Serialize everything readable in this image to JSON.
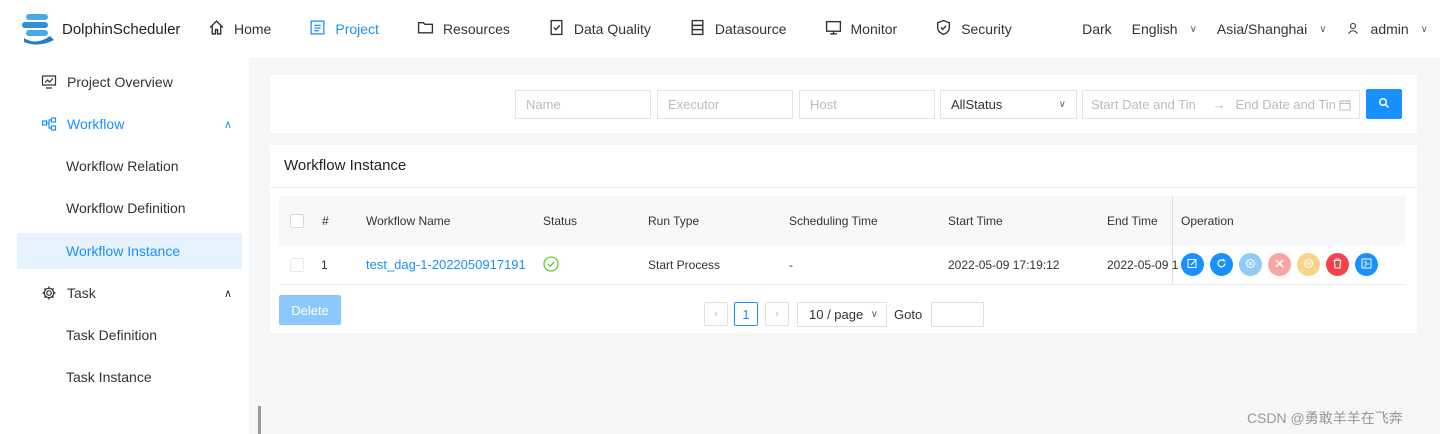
{
  "app": {
    "name": "DolphinScheduler"
  },
  "nav": [
    {
      "label": "Home",
      "icon": "home-icon",
      "active": false
    },
    {
      "label": "Project",
      "icon": "project-icon",
      "active": true
    },
    {
      "label": "Resources",
      "icon": "folder-icon",
      "active": false
    },
    {
      "label": "Data Quality",
      "icon": "data-quality-icon",
      "active": false
    },
    {
      "label": "Datasource",
      "icon": "datasource-icon",
      "active": false
    },
    {
      "label": "Monitor",
      "icon": "monitor-icon",
      "active": false
    },
    {
      "label": "Security",
      "icon": "shield-icon",
      "active": false
    }
  ],
  "header_right": {
    "theme": "Dark",
    "language": "English",
    "timezone": "Asia/Shanghai",
    "user": "admin"
  },
  "sidebar": {
    "items": [
      {
        "label": "Project Overview",
        "icon": "overview-icon"
      },
      {
        "label": "Workflow",
        "icon": "workflow-icon"
      },
      {
        "label": "Workflow Relation"
      },
      {
        "label": "Workflow Definition"
      },
      {
        "label": "Workflow Instance"
      },
      {
        "label": "Task",
        "icon": "settings-icon"
      },
      {
        "label": "Task Definition"
      },
      {
        "label": "Task Instance"
      }
    ]
  },
  "filters": {
    "name_placeholder": "Name",
    "executor_placeholder": "Executor",
    "host_placeholder": "Host",
    "status_value": "AllStatus",
    "start_date_placeholder": "Start Date and Tin",
    "end_date_placeholder": "End Date and Tin"
  },
  "card": {
    "title": "Workflow Instance"
  },
  "table": {
    "headers": [
      "#",
      "Workflow Name",
      "Status",
      "Run Type",
      "Scheduling Time",
      "Start Time",
      "End Time",
      "Operation"
    ],
    "rows": [
      {
        "index": "1",
        "name": "test_dag-1-2022050917191",
        "status": "success",
        "run_type": "Start Process",
        "scheduling_time": "-",
        "start_time": "2022-05-09 17:19:12",
        "end_time": "2022-05-09 1"
      }
    ],
    "operations": [
      {
        "name": "edit-icon",
        "color": "#1890ff"
      },
      {
        "name": "rerun-icon",
        "color": "#1890ff"
      },
      {
        "name": "recover-icon",
        "color": "#8ecbf5"
      },
      {
        "name": "stop-icon",
        "color": "#f7a5a5"
      },
      {
        "name": "pause-icon",
        "color": "#f6d58b"
      },
      {
        "name": "delete-icon",
        "color": "#f5414a"
      },
      {
        "name": "gantt-icon",
        "color": "#1890ff"
      }
    ]
  },
  "footer": {
    "delete_label": "Delete",
    "page": "1",
    "page_size": "10 / page",
    "goto_label": "Goto"
  },
  "watermark": "CSDN @勇敢羊羊在飞奔"
}
